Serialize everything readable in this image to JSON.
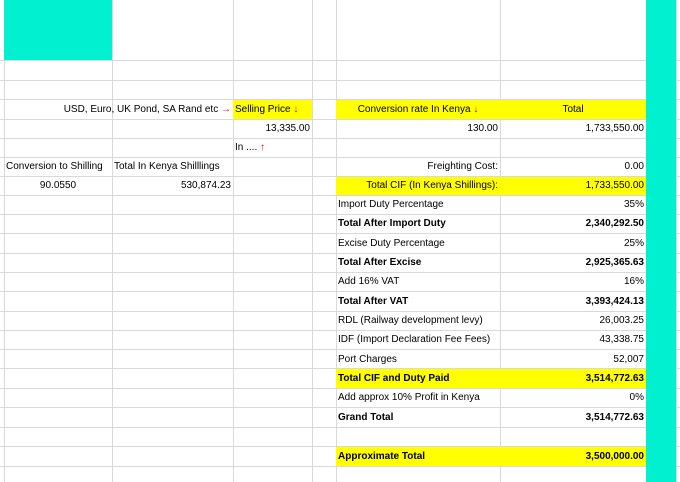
{
  "colors": {
    "teal": "#00f0d0",
    "yellow": "#ffff00",
    "arrow": "#e00000",
    "grid": "#d9d9d9"
  },
  "header_row": {
    "currencies": "USD, Euro, UK Pond, SA Rand etc",
    "selling_price": "Selling Price",
    "conversion_rate": "Conversion rate In Kenya",
    "total": "Total",
    "arrow_right": "→",
    "arrow_down": "↓",
    "arrow_up": "↑"
  },
  "values_row": {
    "selling_price": "13,335.00",
    "conversion_rate": "130.00",
    "total": "1,733,550.00"
  },
  "in_note": "In ....",
  "left_block": {
    "conversion_label": "Conversion to Shilling",
    "total_label": "Total In Kenya Shilllings",
    "conversion_value": "90.0550",
    "total_value": "530,874.23"
  },
  "freighting": {
    "label": "Freighting Cost:",
    "value": "0.00"
  },
  "summary_rows": [
    {
      "label": "Total CIF (In Kenya Shillings):",
      "value": "1,733,550.00"
    },
    {
      "label": "Import Duty Percentage",
      "value": "35%"
    },
    {
      "label": "Total After Import Duty",
      "value": "2,340,292.50"
    },
    {
      "label": "Excise Duty Percentage",
      "value": "25%"
    },
    {
      "label": "Total After Excise",
      "value": "2,925,365.63"
    },
    {
      "label": "Add 16% VAT",
      "value": "16%"
    },
    {
      "label": "Total After VAT",
      "value": "3,393,424.13"
    },
    {
      "label": "RDL (Railway development levy)",
      "value": "26,003.25"
    },
    {
      "label": "IDF (Import Declaration Fee Fees)",
      "value": "43,338.75"
    },
    {
      "label": "Port Charges",
      "value": "52,007"
    },
    {
      "label": "Total CIF and Duty Paid",
      "value": "3,514,772.63"
    },
    {
      "label": "Add approx 10% Profit in Kenya",
      "value": "0%"
    },
    {
      "label": "Grand Total",
      "value": "3,514,772.63"
    }
  ],
  "approx_total": {
    "label": "Approximate Total",
    "value": "3,500,000.00"
  }
}
